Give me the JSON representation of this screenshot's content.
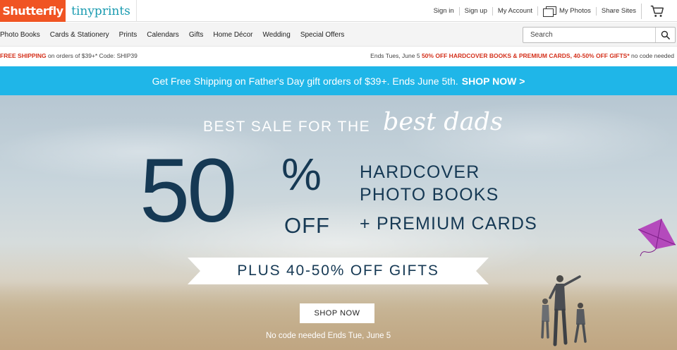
{
  "brand": {
    "primary": "Shutterfly",
    "secondary": "tinyprints"
  },
  "toplinks": {
    "sign_in": "Sign in",
    "sign_up": "Sign up",
    "my_account": "My Account",
    "my_photos": "My Photos",
    "share_sites": "Share Sites"
  },
  "nav": {
    "items": [
      "Photo Books",
      "Cards & Stationery",
      "Prints",
      "Calendars",
      "Gifts",
      "Home Décor",
      "Wedding",
      "Special Offers"
    ],
    "search_placeholder": "Search"
  },
  "promo": {
    "left_bold": "FREE SHIPPING",
    "left_rest": " on orders of $39+* Code: SHIP39",
    "right_prefix": "Ends Tues, June 5 ",
    "right_bold": "50% OFF HARDCOVER BOOKS & PREMIUM CARDS, 40-50% OFF GIFTS*",
    "right_suffix": " no code needed"
  },
  "banner": {
    "text": "Get Free Shipping on Father's Day gift orders of $39+. Ends June 5th.",
    "cta": "SHOP NOW >"
  },
  "hero": {
    "tagline": "BEST SALE FOR THE",
    "tagline_script": "best dads",
    "big_number": "50",
    "percent": "%",
    "off": "OFF",
    "line1": "HARDCOVER",
    "line2": "PHOTO BOOKS",
    "line3": "+ PREMIUM CARDS",
    "ribbon": "PLUS 40-50% OFF GIFTS",
    "cta": "SHOP NOW",
    "footnote": "No code needed   Ends Tue, June 5"
  },
  "colors": {
    "shutterfly_orange": "#f05423",
    "tinyprints_teal": "#1a9bb0",
    "promo_red": "#d4311c",
    "banner_blue": "#1fb6e8",
    "hero_navy": "#163954",
    "kite_purple": "#b03ab8"
  }
}
